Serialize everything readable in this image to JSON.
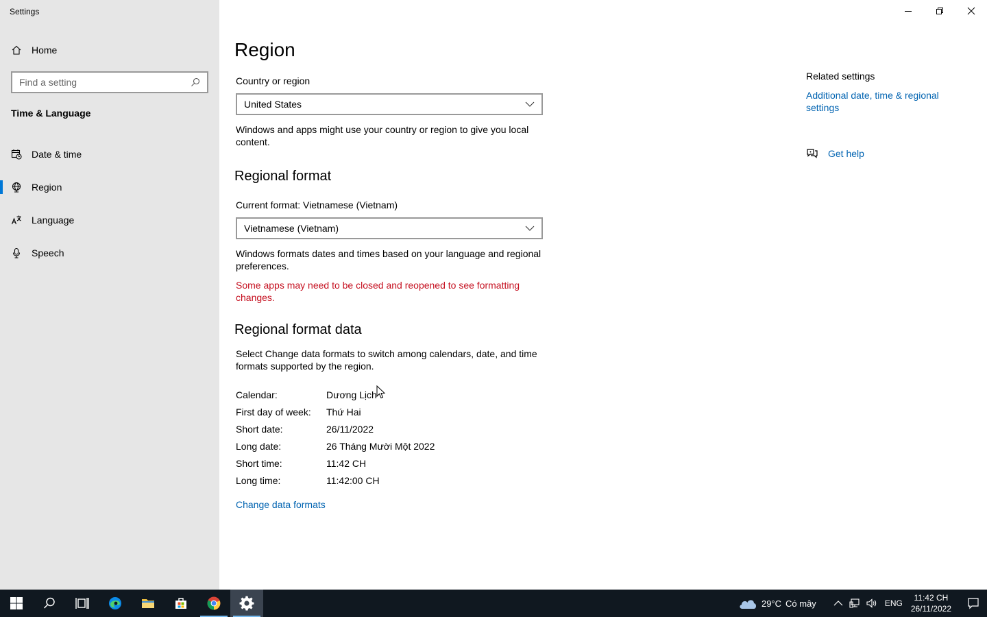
{
  "window": {
    "title": "Settings"
  },
  "sidebar": {
    "home_label": "Home",
    "search_placeholder": "Find a setting",
    "section_title": "Time & Language",
    "items": [
      {
        "label": "Date & time",
        "icon": "calendar-clock-icon"
      },
      {
        "label": "Region",
        "icon": "globe-icon",
        "active": true
      },
      {
        "label": "Language",
        "icon": "language-icon"
      },
      {
        "label": "Speech",
        "icon": "microphone-icon"
      }
    ]
  },
  "main": {
    "title": "Region",
    "country": {
      "label": "Country or region",
      "value": "United States",
      "description": "Windows and apps might use your country or region to give you local content."
    },
    "regional_format": {
      "heading": "Regional format",
      "label": "Current format: Vietnamese (Vietnam)",
      "value": "Vietnamese (Vietnam)",
      "description": "Windows formats dates and times based on your language and regional preferences.",
      "warning": "Some apps may need to be closed and reopened to see formatting changes."
    },
    "format_data": {
      "heading": "Regional format data",
      "description": "Select Change data formats to switch among calendars, date, and time formats supported by the region.",
      "rows": [
        {
          "key": "Calendar:",
          "value": "Dương Lịch"
        },
        {
          "key": "First day of week:",
          "value": "Thứ Hai"
        },
        {
          "key": "Short date:",
          "value": "26/11/2022"
        },
        {
          "key": "Long date:",
          "value": "26 Tháng Mười Một 2022"
        },
        {
          "key": "Short time:",
          "value": "11:42 CH"
        },
        {
          "key": "Long time:",
          "value": "11:42:00 CH"
        }
      ],
      "change_link": "Change data formats"
    }
  },
  "related": {
    "title": "Related settings",
    "link": "Additional date, time & regional settings",
    "help": "Get help"
  },
  "taskbar": {
    "weather": {
      "temp": "29°C",
      "condition": "Có mây"
    },
    "language": "ENG",
    "time": "11:42 CH",
    "date": "26/11/2022"
  },
  "colors": {
    "accent": "#0078d7",
    "link": "#0063b1",
    "warning": "#c50f1f",
    "sidebar_bg": "#e6e6e6",
    "taskbar_bg": "#101820"
  }
}
